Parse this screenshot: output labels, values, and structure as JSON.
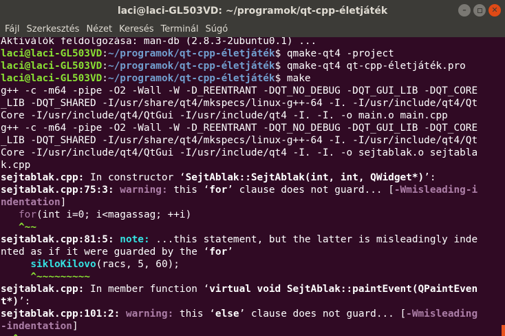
{
  "window": {
    "title": "laci@laci-GL503VD: ~/programok/qt-cpp-életjáték"
  },
  "menu": [
    "Fájl",
    "Szerkesztés",
    "Nézet",
    "Keresés",
    "Terminál",
    "Súgó"
  ],
  "terminal": {
    "lines": [
      [
        {
          "t": "Aktiválók feldolgozása: man-db (2.8.3-2ubuntu0.1) ..."
        }
      ],
      [
        {
          "t": "laci@laci-GL503VD",
          "c": "g"
        },
        {
          "t": ":"
        },
        {
          "t": "~/programok/qt-cpp-életjáték",
          "c": "b"
        },
        {
          "t": "$ qmake-qt4 -project"
        }
      ],
      [
        {
          "t": "laci@laci-GL503VD",
          "c": "g"
        },
        {
          "t": ":"
        },
        {
          "t": "~/programok/qt-cpp-életjáték",
          "c": "b"
        },
        {
          "t": "$ qmake-qt4 qt-cpp-életjáték.pro"
        }
      ],
      [
        {
          "t": "laci@laci-GL503VD",
          "c": "g"
        },
        {
          "t": ":"
        },
        {
          "t": "~/programok/qt-cpp-életjáték",
          "c": "b"
        },
        {
          "t": "$ make"
        }
      ],
      [
        {
          "t": "g++ -c -m64 -pipe -O2 -Wall -W -D_REENTRANT -DQT_NO_DEBUG -DQT_GUI_LIB -DQT_CORE"
        }
      ],
      [
        {
          "t": "_LIB -DQT_SHARED -I/usr/share/qt4/mkspecs/linux-g++-64 -I. -I/usr/include/qt4/Qt"
        }
      ],
      [
        {
          "t": "Core -I/usr/include/qt4/QtGui -I/usr/include/qt4 -I. -I. -o main.o main.cpp"
        }
      ],
      [
        {
          "t": "g++ -c -m64 -pipe -O2 -Wall -W -D_REENTRANT -DQT_NO_DEBUG -DQT_GUI_LIB -DQT_CORE"
        }
      ],
      [
        {
          "t": "_LIB -DQT_SHARED -I/usr/share/qt4/mkspecs/linux-g++-64 -I. -I/usr/include/qt4/Qt"
        }
      ],
      [
        {
          "t": "Core -I/usr/include/qt4/QtGui -I/usr/include/qt4 -I. -I. -o sejtablak.o sejtabla"
        }
      ],
      [
        {
          "t": "k.cpp"
        }
      ],
      [
        {
          "t": "sejtablak.cpp:",
          "c": "bold"
        },
        {
          "t": " In constructor ‘"
        },
        {
          "t": "SejtAblak::SejtAblak(int, int, QWidget*)",
          "c": "bold"
        },
        {
          "t": "’:"
        }
      ],
      [
        {
          "t": "sejtablak.cpp:75:3:",
          "c": "bold"
        },
        {
          "t": " "
        },
        {
          "t": "warning:",
          "c": "mag"
        },
        {
          "t": " this ‘"
        },
        {
          "t": "for",
          "c": "bold"
        },
        {
          "t": "’ clause does not guard... ["
        },
        {
          "t": "-Wmisleading-i",
          "c": "mag"
        }
      ],
      [
        {
          "t": "ndentation",
          "c": "mag"
        },
        {
          "t": "]"
        }
      ],
      [
        {
          "t": "   "
        },
        {
          "t": "for",
          "c": "magn"
        },
        {
          "t": "(int i=0; i<magassag; ++i)"
        }
      ],
      [
        {
          "t": "   "
        },
        {
          "t": "^~~",
          "c": "gr"
        }
      ],
      [
        {
          "t": "sejtablak.cpp:81:5:",
          "c": "bold"
        },
        {
          "t": " "
        },
        {
          "t": "note:",
          "c": "cy"
        },
        {
          "t": " ...this statement, but the latter is misleadingly inde"
        }
      ],
      [
        {
          "t": "nted as if it were guarded by the ‘"
        },
        {
          "t": "for",
          "c": "bold"
        },
        {
          "t": "’"
        }
      ],
      [
        {
          "t": "     "
        },
        {
          "t": "sikloKilovo",
          "c": "cy"
        },
        {
          "t": "(racs, 5, 60);"
        }
      ],
      [
        {
          "t": "     "
        },
        {
          "t": "^~~~~~~~~~",
          "c": "gr"
        }
      ],
      [
        {
          "t": "sejtablak.cpp:",
          "c": "bold"
        },
        {
          "t": " In member function ‘"
        },
        {
          "t": "virtual void SejtAblak::paintEvent(QPaintEven",
          "c": "bold"
        }
      ],
      [
        {
          "t": "t*)",
          "c": "bold"
        },
        {
          "t": "’:"
        }
      ],
      [
        {
          "t": "sejtablak.cpp:101:2:",
          "c": "bold"
        },
        {
          "t": " "
        },
        {
          "t": "warning:",
          "c": "mag"
        },
        {
          "t": " this ‘"
        },
        {
          "t": "else",
          "c": "bold"
        },
        {
          "t": "’ clause does not guard... ["
        },
        {
          "t": "-Wmisleading",
          "c": "mag"
        }
      ],
      [
        {
          "t": "-indentation",
          "c": "mag"
        },
        {
          "t": "]"
        }
      ],
      [
        {
          "t": "  ^~~~",
          "c": "gr"
        }
      ]
    ]
  }
}
